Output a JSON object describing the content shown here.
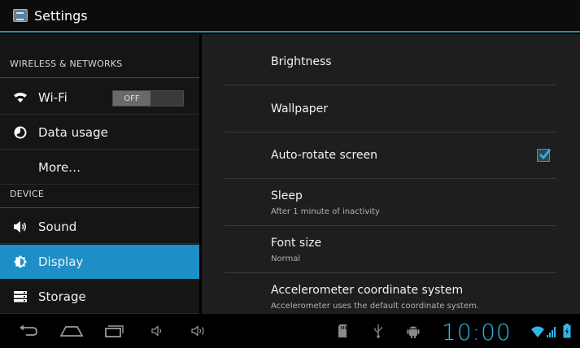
{
  "window": {
    "title": "Settings",
    "icon": "settings-app-icon"
  },
  "sidebar": {
    "sections": [
      {
        "header": "WIRELESS & NETWORKS"
      },
      {
        "header": "DEVICE"
      }
    ],
    "items": [
      {
        "label": "Wi-Fi",
        "icon": "wifi-icon",
        "toggle_label": "OFF"
      },
      {
        "label": "Data usage",
        "icon": "data-usage-icon"
      },
      {
        "label": "More…",
        "icon": ""
      },
      {
        "label": "Sound",
        "icon": "speaker-icon"
      },
      {
        "label": "Display",
        "icon": "brightness-icon",
        "selected": true
      },
      {
        "label": "Storage",
        "icon": "storage-icon"
      }
    ]
  },
  "display_settings": [
    {
      "title": "Brightness",
      "subtitle": ""
    },
    {
      "title": "Wallpaper",
      "subtitle": ""
    },
    {
      "title": "Auto-rotate screen",
      "subtitle": "",
      "checked": true
    },
    {
      "title": "Sleep",
      "subtitle": "After 1 minute of inactivity"
    },
    {
      "title": "Font size",
      "subtitle": "Normal"
    },
    {
      "title": "Accelerometer coordinate system",
      "subtitle": "Accelerometer uses the default coordinate system."
    }
  ],
  "status_bar": {
    "time": "10:00"
  },
  "colors": {
    "accent": "#33b5e5",
    "selected": "#1e8fc6",
    "divider": "#2f8fb5"
  }
}
